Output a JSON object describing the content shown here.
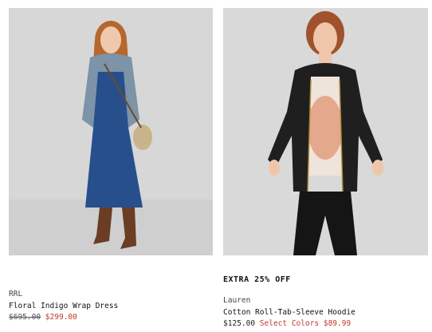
{
  "products": [
    {
      "brand": "RRL",
      "name": "Floral Indigo Wrap Dress",
      "original_price": "$695.00",
      "sale_price": "$299.00",
      "colors": {
        "background": "#d7d7d7",
        "accent": "#c0392b"
      }
    },
    {
      "promo": "EXTRA 25% OFF",
      "brand": "Lauren",
      "name": "Cotton Roll-Tab-Sleeve Hoodie",
      "price": "$125.00",
      "select_colors_label": "Select Colors $89.99",
      "colors": {
        "background": "#d9d9d9",
        "accent": "#c0392b"
      }
    }
  ]
}
